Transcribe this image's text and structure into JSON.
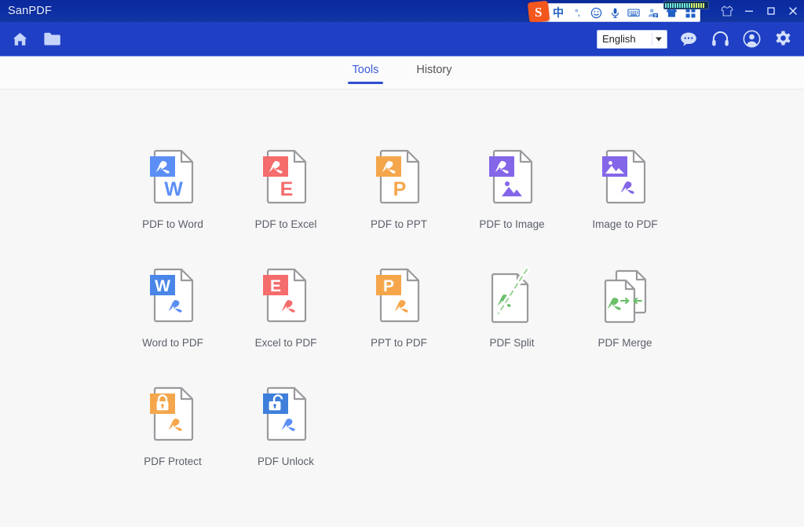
{
  "window": {
    "title": "SanPDF",
    "controls": [
      {
        "name": "theme-skin",
        "icon": "tshirt-icon"
      },
      {
        "name": "minimize",
        "icon": "minimize-icon"
      },
      {
        "name": "maximize",
        "icon": "maximize-icon"
      },
      {
        "name": "close",
        "icon": "close-icon"
      }
    ]
  },
  "ime": {
    "logo_text": "S",
    "items": [
      {
        "name": "ime-chinese-mode",
        "label": "中",
        "icon": "chinese-mode-icon"
      },
      {
        "name": "ime-punctuation",
        "label": "°,",
        "icon": "halfwidth-punctuation-icon"
      },
      {
        "name": "ime-emoji",
        "label": "",
        "icon": "smiley-icon"
      },
      {
        "name": "ime-voice",
        "label": "",
        "icon": "microphone-icon"
      },
      {
        "name": "ime-keyboard",
        "label": "",
        "icon": "keyboard-icon"
      },
      {
        "name": "ime-user",
        "label": "",
        "icon": "user-card-icon"
      },
      {
        "name": "ime-skin",
        "label": "",
        "icon": "tshirt-icon"
      },
      {
        "name": "ime-toolbox",
        "label": "",
        "icon": "grid-toolbox-icon"
      }
    ]
  },
  "toolbar": {
    "left_icons": [
      {
        "name": "home-button",
        "icon": "home-icon"
      },
      {
        "name": "open-file-button",
        "icon": "folder-open-icon"
      }
    ],
    "language": {
      "value": "English",
      "placeholder": "English",
      "options": [
        "English"
      ]
    },
    "right_icons": [
      {
        "name": "feedback-button",
        "icon": "chat-bubble-icon"
      },
      {
        "name": "support-button",
        "icon": "headset-icon"
      },
      {
        "name": "account-button",
        "icon": "user-avatar-icon"
      },
      {
        "name": "settings-button",
        "icon": "gear-icon"
      }
    ]
  },
  "tabs": [
    {
      "name": "tab-tools",
      "label": "Tools",
      "active": true
    },
    {
      "name": "tab-history",
      "label": "History",
      "active": false
    }
  ],
  "colors": {
    "titlebar": "#0d2fa6",
    "toolbar": "#1f3fc4",
    "accent": "#2f4fd0",
    "page_bg": "#f7f7f8",
    "doc_outline": "#9a9a9e",
    "blue": "#5b8ff5",
    "red": "#f56c6c",
    "orange": "#f5a council",
    "orange_hex": "#f5a council"
  },
  "tools": {
    "rows": [
      [
        {
          "name": "tool-pdf-to-word",
          "label": "PDF to Word",
          "badge": "pdf",
          "badge_color": "#5b8ff5",
          "body": "letter",
          "body_text": "W",
          "body_color": "#5b8ff5"
        },
        {
          "name": "tool-pdf-to-excel",
          "label": "PDF to Excel",
          "badge": "pdf",
          "badge_color": "#f56c6c",
          "body": "letter",
          "body_text": "E",
          "body_color": "#f56c6c"
        },
        {
          "name": "tool-pdf-to-ppt",
          "label": "PDF to PPT",
          "badge": "pdf",
          "badge_color": "#f5a64b",
          "body": "letter",
          "body_text": "P",
          "body_color": "#f5a64b"
        },
        {
          "name": "tool-pdf-to-image",
          "label": "PDF to Image",
          "badge": "pdf",
          "badge_color": "#8466e8",
          "body": "image",
          "body_text": "",
          "body_color": "#8466e8"
        },
        {
          "name": "tool-image-to-pdf",
          "label": "Image to PDF",
          "badge": "image",
          "badge_color": "#8466e8",
          "body": "pdf",
          "body_text": "",
          "body_color": "#8466e8"
        }
      ],
      [
        {
          "name": "tool-word-to-pdf",
          "label": "Word to PDF",
          "badge": "letter",
          "badge_text": "W",
          "badge_color": "#4a86e8",
          "body": "pdf",
          "body_text": "",
          "body_color": "#5b8ff5"
        },
        {
          "name": "tool-excel-to-pdf",
          "label": "Excel to PDF",
          "badge": "letter",
          "badge_text": "E",
          "badge_color": "#f56c6c",
          "body": "pdf",
          "body_text": "",
          "body_color": "#f56c6c"
        },
        {
          "name": "tool-ppt-to-pdf",
          "label": "PPT to PDF",
          "badge": "letter",
          "badge_text": "P",
          "badge_color": "#f5a64b",
          "body": "pdf",
          "body_text": "",
          "body_color": "#f5a64b"
        },
        {
          "name": "tool-pdf-split",
          "label": "PDF Split",
          "badge": "none",
          "body": "split",
          "body_text": "",
          "body_color": "#6abf69"
        },
        {
          "name": "tool-pdf-merge",
          "label": "PDF Merge",
          "badge": "none",
          "body": "merge",
          "body_text": "",
          "body_color": "#6abf69"
        }
      ],
      [
        {
          "name": "tool-pdf-protect",
          "label": "PDF Protect",
          "badge": "lock-closed",
          "badge_color": "#f5a64b",
          "body": "pdf",
          "body_text": "",
          "body_color": "#f5a64b"
        },
        {
          "name": "tool-pdf-unlock",
          "label": "PDF Unlock",
          "badge": "lock-open",
          "badge_color": "#3f7fdb",
          "body": "pdf",
          "body_text": "",
          "body_color": "#5b8ff5"
        }
      ]
    ]
  }
}
